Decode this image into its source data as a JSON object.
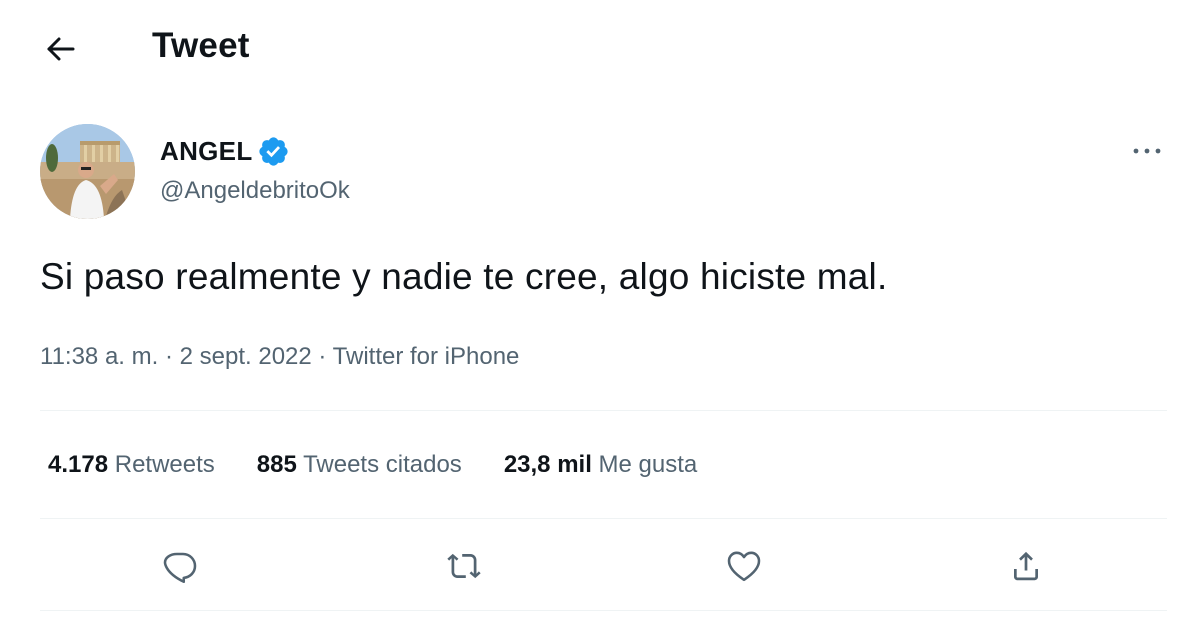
{
  "header": {
    "title": "Tweet",
    "back_icon": "arrow-left-icon"
  },
  "author": {
    "display_name": "ANGEL",
    "handle": "@AngeldebritoOk",
    "verified": true,
    "verified_color": "#1d9bf0"
  },
  "tweet": {
    "text": "Si paso realmente y nadie te cree, algo hiciste mal.",
    "time": "11:38 a. m.",
    "separator": "·",
    "date": "2 sept. 2022",
    "source": "Twitter for iPhone"
  },
  "stats": {
    "retweets_count": "4.178",
    "retweets_label": "Retweets",
    "quotes_count": "885",
    "quotes_label": "Tweets citados",
    "likes_count": "23,8 mil",
    "likes_label": "Me gusta"
  },
  "actions": {
    "reply_icon": "reply-icon",
    "retweet_icon": "retweet-icon",
    "like_icon": "heart-icon",
    "share_icon": "share-icon"
  },
  "colors": {
    "text_primary": "#0f1419",
    "text_secondary": "#536471",
    "divider": "#eff3f4"
  }
}
